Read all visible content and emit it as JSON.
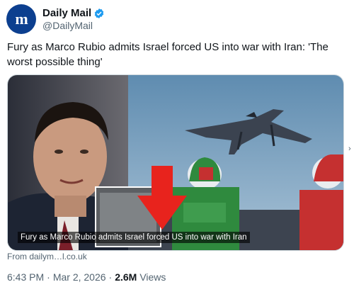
{
  "account": {
    "display_name": "Daily Mail",
    "handle": "@DailyMail",
    "avatar_glyph": "m",
    "verified": true,
    "brand_color": "#0c3f8f",
    "verified_color": "#1d9bf0"
  },
  "tweet": {
    "text": "Fury as Marco Rubio admits Israel forced US into war with Iran: 'The worst possible thing'"
  },
  "media": {
    "caption": "Fury as Marco Rubio admits Israel forced US into war with Iran",
    "source_label": "From dailym…l.co.uk",
    "arrow_color": "#e8231d"
  },
  "meta": {
    "time": "6:43 PM",
    "date": "Mar 2, 2026",
    "views_count": "2.6M",
    "views_label": "Views"
  }
}
